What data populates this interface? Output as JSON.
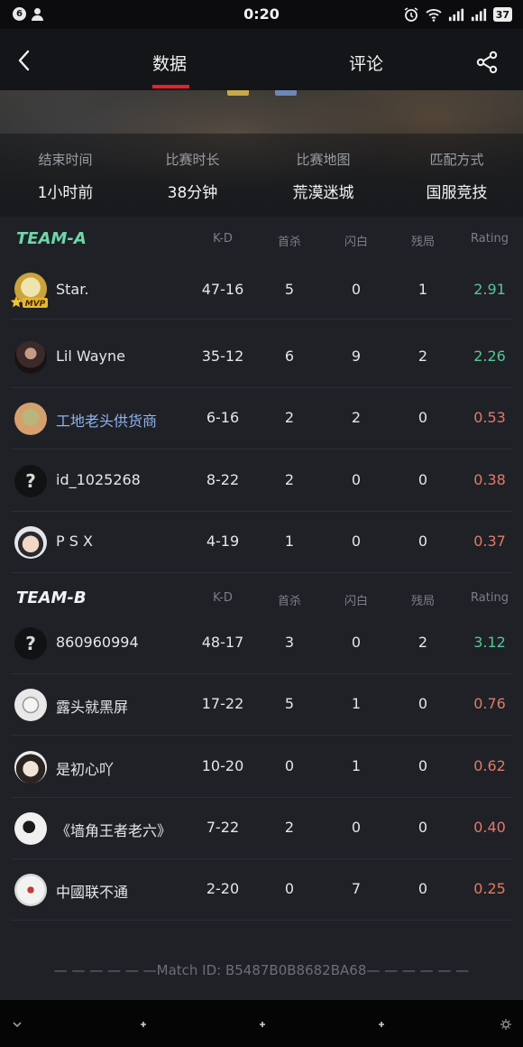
{
  "status_bar": {
    "notification_count": "6",
    "time": "0:20",
    "battery": "37"
  },
  "nav": {
    "tabs": [
      {
        "label": "数据",
        "active": true
      },
      {
        "label": "评论",
        "active": false
      }
    ],
    "accent_color": "#e8202a"
  },
  "match_info": [
    {
      "label": "结束时间",
      "value": "1小时前"
    },
    {
      "label": "比赛时长",
      "value": "38分钟"
    },
    {
      "label": "比赛地图",
      "value": "荒漠迷城"
    },
    {
      "label": "匹配方式",
      "value": "国服竞技"
    }
  ],
  "columns": [
    "K-D",
    "首杀",
    "闪白",
    "残局",
    "Rating"
  ],
  "teams": [
    {
      "name": "TEAM-A",
      "color": "#6fd6a8",
      "players": [
        {
          "name": "Star.",
          "kd": "47-16",
          "first_kill": "5",
          "flash": "0",
          "clutch": "1",
          "rating": "2.91",
          "rating_level": "high",
          "mvp": true,
          "mvp_label": "MVP",
          "avatar": "gold-frame-avatar"
        },
        {
          "name": "Lil Wayne",
          "kd": "35-12",
          "first_kill": "6",
          "flash": "9",
          "clutch": "2",
          "rating": "2.26",
          "rating_level": "high",
          "avatar": "dark-portrait-avatar"
        },
        {
          "name": "工地老头供货商",
          "kd": "6-16",
          "first_kill": "2",
          "flash": "2",
          "clutch": "0",
          "rating": "0.53",
          "rating_level": "low",
          "highlight": true,
          "avatar": "cartoon-avatar"
        },
        {
          "name": "id_1025268",
          "kd": "8-22",
          "first_kill": "2",
          "flash": "0",
          "clutch": "0",
          "rating": "0.38",
          "rating_level": "low",
          "avatar": "question-mark-avatar"
        },
        {
          "name": "P S X",
          "kd": "4-19",
          "first_kill": "1",
          "flash": "0",
          "clutch": "0",
          "rating": "0.37",
          "rating_level": "low",
          "avatar": "face-avatar"
        }
      ]
    },
    {
      "name": "TEAM-B",
      "color": "#f2f2f2",
      "players": [
        {
          "name": "860960994",
          "kd": "48-17",
          "first_kill": "3",
          "flash": "0",
          "clutch": "2",
          "rating": "3.12",
          "rating_level": "high",
          "avatar": "question-mark-avatar"
        },
        {
          "name": "露头就黑屏",
          "kd": "17-22",
          "first_kill": "5",
          "flash": "1",
          "clutch": "0",
          "rating": "0.76",
          "rating_level": "low",
          "avatar": "sketch-avatar"
        },
        {
          "name": "是初心吖",
          "kd": "10-20",
          "first_kill": "0",
          "flash": "1",
          "clutch": "0",
          "rating": "0.62",
          "rating_level": "low",
          "avatar": "girl-avatar"
        },
        {
          "name": "《墙角王者老六》",
          "kd": "7-22",
          "first_kill": "2",
          "flash": "0",
          "clutch": "0",
          "rating": "0.40",
          "rating_level": "low",
          "avatar": "meme-avatar"
        },
        {
          "name": "中國联不通",
          "kd": "2-20",
          "first_kill": "0",
          "flash": "7",
          "clutch": "0",
          "rating": "0.25",
          "rating_level": "low",
          "avatar": "astronaut-avatar"
        }
      ]
    }
  ],
  "match_id": "— — — — — —Match ID: B5487B0B8682BA68— — — — — —",
  "colors": {
    "rating_high": "#55c793",
    "rating_low": "#e27a66",
    "highlight_name": "#8fb3ef"
  }
}
